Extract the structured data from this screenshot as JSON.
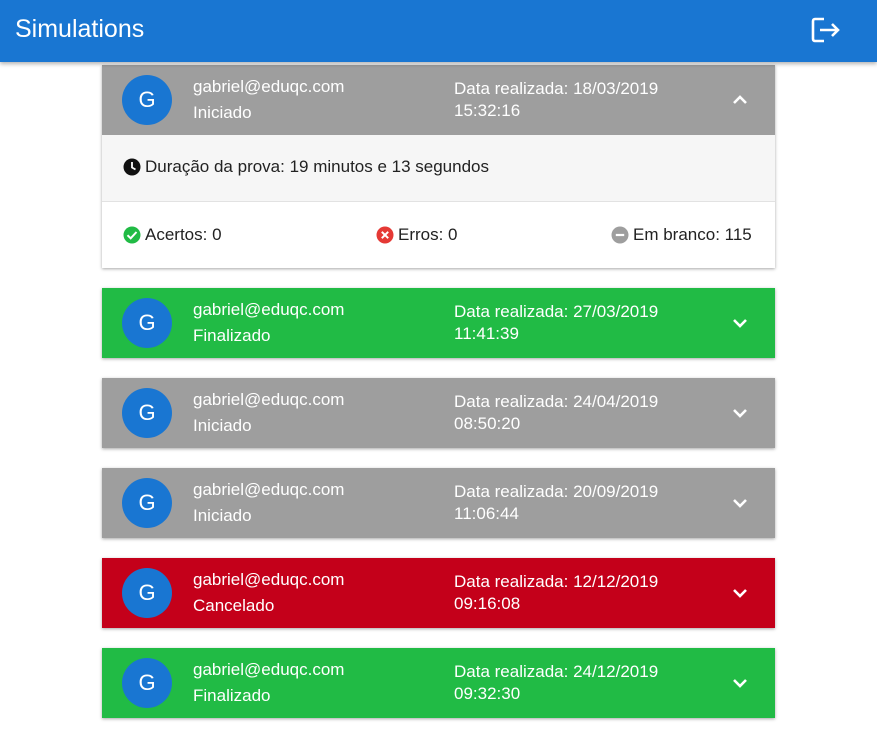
{
  "appbar": {
    "title": "Simulations",
    "logout_icon": "logout-icon"
  },
  "colors": {
    "primary": "#1976d2",
    "iniciado": "#9e9e9e",
    "finalizado": "#21bb45",
    "cancelado": "#c4001a"
  },
  "simulations": [
    {
      "avatar": "G",
      "email": "gabriel@eduqc.com",
      "status": "Iniciado",
      "date_line1": "Data realizada: 18/03/2019",
      "date_line2": "15:32:16",
      "expanded": true,
      "details": {
        "duration": "Duração da prova: 19 minutos e 13 segundos",
        "acertos": "Acertos: 0",
        "erros": "Erros: 0",
        "em_branco": "Em branco: 115"
      }
    },
    {
      "avatar": "G",
      "email": "gabriel@eduqc.com",
      "status": "Finalizado",
      "date_line1": "Data realizada: 27/03/2019",
      "date_line2": "11:41:39",
      "expanded": false
    },
    {
      "avatar": "G",
      "email": "gabriel@eduqc.com",
      "status": "Iniciado",
      "date_line1": "Data realizada: 24/04/2019",
      "date_line2": "08:50:20",
      "expanded": false
    },
    {
      "avatar": "G",
      "email": "gabriel@eduqc.com",
      "status": "Iniciado",
      "date_line1": "Data realizada: 20/09/2019",
      "date_line2": "11:06:44",
      "expanded": false
    },
    {
      "avatar": "G",
      "email": "gabriel@eduqc.com",
      "status": "Cancelado",
      "date_line1": "Data realizada: 12/12/2019",
      "date_line2": "09:16:08",
      "expanded": false
    },
    {
      "avatar": "G",
      "email": "gabriel@eduqc.com",
      "status": "Finalizado",
      "date_line1": "Data realizada: 24/12/2019",
      "date_line2": "09:32:30",
      "expanded": false
    }
  ]
}
